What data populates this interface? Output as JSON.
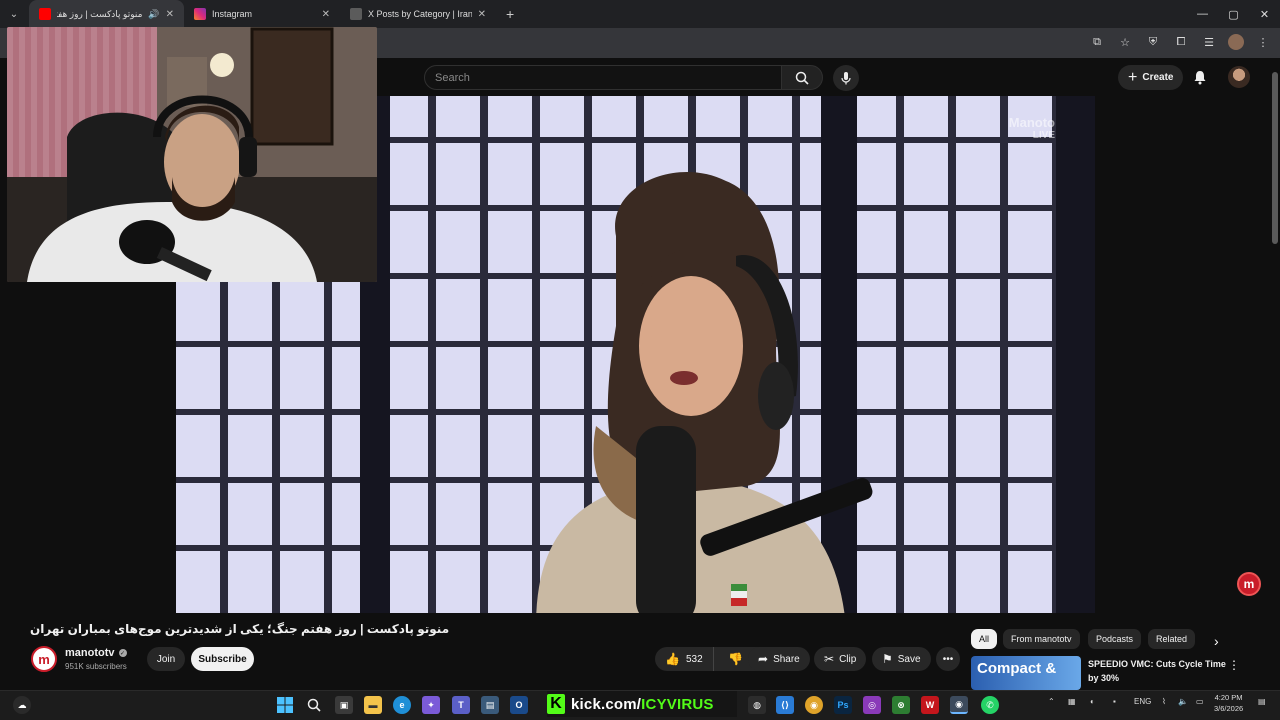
{
  "browser": {
    "tabs": [
      {
        "title": "منوتو پادکست | روز هفتم جنگ",
        "favicon_color": "#ff0000",
        "active": true
      },
      {
        "title": "Instagram",
        "favicon_color": "#e1306c",
        "active": false
      },
      {
        "title": "X Posts by Category | Iran Moni",
        "favicon_color": "#5b5b5b",
        "active": false
      }
    ],
    "new_tab": "+"
  },
  "youtube": {
    "search_placeholder": "Search",
    "create_label": "Create"
  },
  "video": {
    "watermark_top": "Manoto",
    "watermark_bottom": "LIVE",
    "title": "منوتو پادکست | روز هفتم جنگ؛ یکی از شدیدترین موج‌های بمباران تهران",
    "channel": {
      "name": "manototv",
      "subscribers": "951K subscribers",
      "avatar_letter": "m"
    },
    "join_label": "Join",
    "subscribe_label": "Subscribe",
    "likes": "532",
    "share_label": "Share",
    "clip_label": "Clip",
    "save_label": "Save"
  },
  "chips": [
    "All",
    "From manototv",
    "Podcasts",
    "Related"
  ],
  "recommended": {
    "thumb_text": "Compact &",
    "title": "SPEEDIO VMC: Cuts Cycle Time by 30%"
  },
  "floating_badge": "m",
  "taskbar": {
    "kick_prefix": "kick.com/",
    "kick_user": "ICYVIRUS",
    "language": "ENG",
    "time": "4:20 PM",
    "date": "3/6/2026"
  },
  "colors": {
    "youtube_red": "#ff0000",
    "manoto_red": "#c91d2a",
    "kick_green": "#53fc18"
  }
}
